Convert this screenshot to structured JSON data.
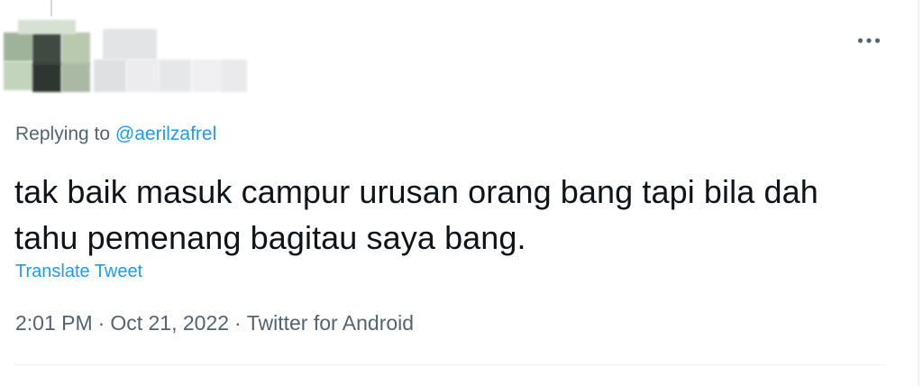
{
  "tweet": {
    "replying_prefix": "Replying to",
    "replying_handle": "@aerilzafrel",
    "text_line1": "tak baik masuk campur urusan orang bang tapi bila dah",
    "text_line2": "tahu pemenang bagitau saya bang.",
    "translate_label": "Translate Tweet",
    "time": "2:01 PM",
    "date": "Oct 21, 2022",
    "source": "Twitter for Android",
    "separator": "·"
  },
  "icons": {
    "more": "more-horizontal-icon"
  },
  "colors": {
    "link": "#1d9bf0",
    "text": "#0f1419",
    "secondary": "#536471"
  }
}
